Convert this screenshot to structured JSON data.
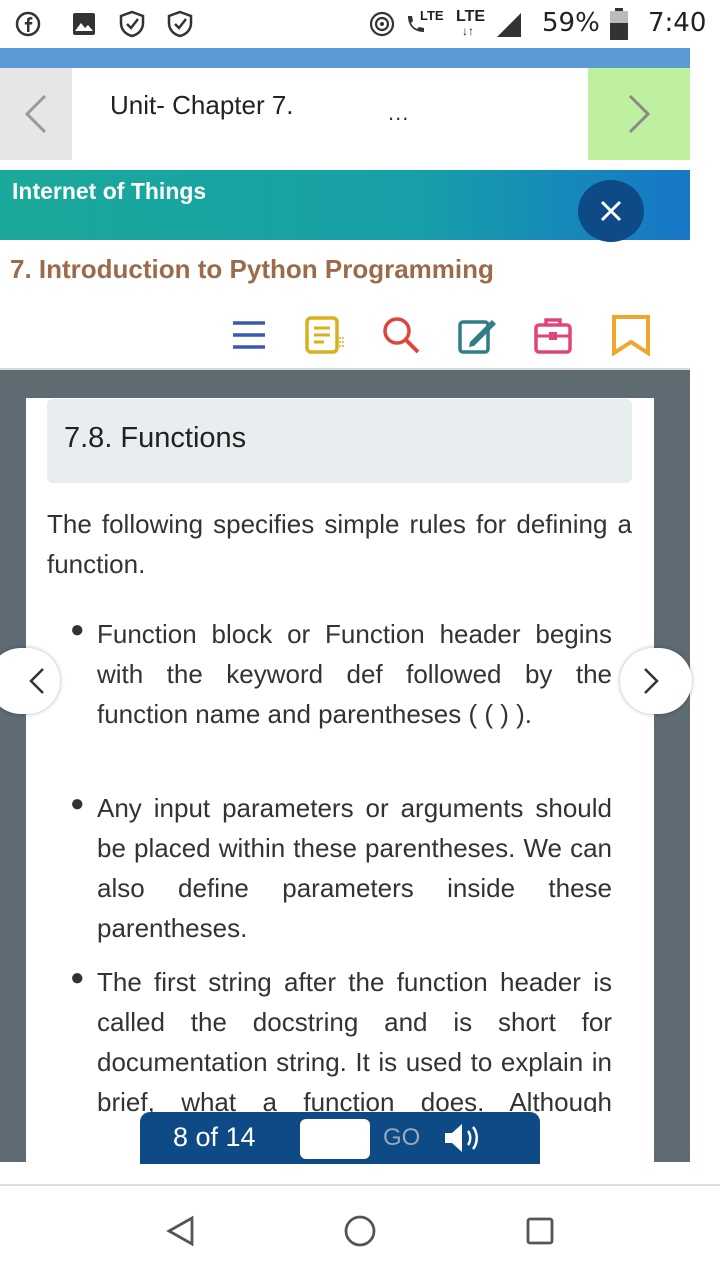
{
  "status_bar": {
    "left_icons": [
      "facebook-icon",
      "image-icon",
      "shield-icon",
      "shield-icon"
    ],
    "lte1": "LTE",
    "lte2": "LTE",
    "battery": "59%",
    "time": "7:40"
  },
  "nav": {
    "chapter_title": "Unit- Chapter 7.",
    "more": "..."
  },
  "banner": {
    "title": "Internet of Things"
  },
  "section_heading": "7. Introduction to Python Programming",
  "toolbar": [
    "menu-icon",
    "notes-icon",
    "search-icon",
    "edit-icon",
    "briefcase-icon",
    "bookmark-icon"
  ],
  "content": {
    "heading": "7.8. Functions",
    "intro": "The following specifies simple rules for defining a function.",
    "bullets": [
      "Function block or Function header begins with the keyword def followed by the function name and parentheses ( ( ) ).",
      "Any input parameters or arguments should be placed within these parentheses. We can also define parameters inside these parentheses.",
      "The first string after the function header is called the docstring and is short for documentation string. It is used to explain in brief, what a function does. Although optional,"
    ]
  },
  "pager": {
    "count": "8 of 14",
    "input_value": "",
    "go": "GO"
  },
  "colors": {
    "banner_start": "#1aa99a",
    "banner_end": "#1676c8",
    "section_heading": "#9c6b4a",
    "pager_bg": "#0e4a86",
    "next_bg": "#bff0a0"
  }
}
